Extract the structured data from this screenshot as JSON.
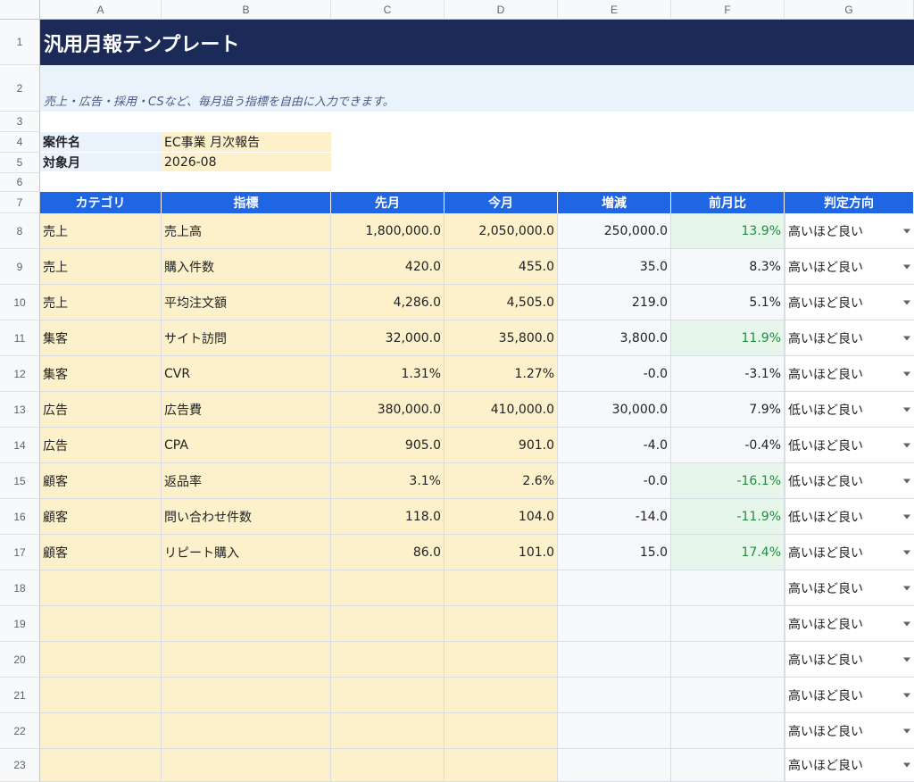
{
  "columns": [
    "A",
    "B",
    "C",
    "D",
    "E",
    "F",
    "G"
  ],
  "row_numbers": [
    "1",
    "2",
    "3",
    "4",
    "5",
    "6",
    "7",
    "8",
    "9",
    "10",
    "11",
    "12",
    "13",
    "14",
    "15",
    "16",
    "17",
    "18",
    "19",
    "20",
    "21",
    "22",
    "23"
  ],
  "title": "汎用月報テンプレート",
  "subtitle": "売上・広告・採用・CSなど、毎月追う指標を自由に入力できます。",
  "info": {
    "case_label": "案件名",
    "case_value": "EC事業 月次報告",
    "month_label": "対象月",
    "month_value": "2026-08"
  },
  "headers": [
    "カテゴリ",
    "指標",
    "先月",
    "今月",
    "増減",
    "前月比",
    "判定方向"
  ],
  "rows": [
    {
      "category": "売上",
      "metric": "売上高",
      "prev": "1,800,000.0",
      "curr": "2,050,000.0",
      "diff": "250,000.0",
      "ratio": "13.9%",
      "direction": "高いほど良い",
      "highlight": true
    },
    {
      "category": "売上",
      "metric": "購入件数",
      "prev": "420.0",
      "curr": "455.0",
      "diff": "35.0",
      "ratio": "8.3%",
      "direction": "高いほど良い",
      "highlight": false
    },
    {
      "category": "売上",
      "metric": "平均注文額",
      "prev": "4,286.0",
      "curr": "4,505.0",
      "diff": "219.0",
      "ratio": "5.1%",
      "direction": "高いほど良い",
      "highlight": false
    },
    {
      "category": "集客",
      "metric": "サイト訪問",
      "prev": "32,000.0",
      "curr": "35,800.0",
      "diff": "3,800.0",
      "ratio": "11.9%",
      "direction": "高いほど良い",
      "highlight": true
    },
    {
      "category": "集客",
      "metric": "CVR",
      "prev": "1.31%",
      "curr": "1.27%",
      "diff": "-0.0",
      "ratio": "-3.1%",
      "direction": "高いほど良い",
      "highlight": false
    },
    {
      "category": "広告",
      "metric": "広告費",
      "prev": "380,000.0",
      "curr": "410,000.0",
      "diff": "30,000.0",
      "ratio": "7.9%",
      "direction": "低いほど良い",
      "highlight": false
    },
    {
      "category": "広告",
      "metric": "CPA",
      "prev": "905.0",
      "curr": "901.0",
      "diff": "-4.0",
      "ratio": "-0.4%",
      "direction": "低いほど良い",
      "highlight": false
    },
    {
      "category": "顧客",
      "metric": "返品率",
      "prev": "3.1%",
      "curr": "2.6%",
      "diff": "-0.0",
      "ratio": "-16.1%",
      "direction": "低いほど良い",
      "highlight": true
    },
    {
      "category": "顧客",
      "metric": "問い合わせ件数",
      "prev": "118.0",
      "curr": "104.0",
      "diff": "-14.0",
      "ratio": "-11.9%",
      "direction": "低いほど良い",
      "highlight": true
    },
    {
      "category": "顧客",
      "metric": "リピート購入",
      "prev": "86.0",
      "curr": "101.0",
      "diff": "15.0",
      "ratio": "17.4%",
      "direction": "高いほど良い",
      "highlight": true
    },
    {
      "category": "",
      "metric": "",
      "prev": "",
      "curr": "",
      "diff": "",
      "ratio": "",
      "direction": "高いほど良い",
      "highlight": false
    },
    {
      "category": "",
      "metric": "",
      "prev": "",
      "curr": "",
      "diff": "",
      "ratio": "",
      "direction": "高いほど良い",
      "highlight": false
    },
    {
      "category": "",
      "metric": "",
      "prev": "",
      "curr": "",
      "diff": "",
      "ratio": "",
      "direction": "高いほど良い",
      "highlight": false
    },
    {
      "category": "",
      "metric": "",
      "prev": "",
      "curr": "",
      "diff": "",
      "ratio": "",
      "direction": "高いほど良い",
      "highlight": false
    },
    {
      "category": "",
      "metric": "",
      "prev": "",
      "curr": "",
      "diff": "",
      "ratio": "",
      "direction": "高いほど良い",
      "highlight": false
    },
    {
      "category": "",
      "metric": "",
      "prev": "",
      "curr": "",
      "diff": "",
      "ratio": "",
      "direction": "高いほど良い",
      "highlight": false
    }
  ],
  "colors": {
    "title_bg": "#1b2a57",
    "subtitle_bg": "#eaf2fc",
    "header_bg": "#1f66e5",
    "input_bg": "#fdf1cc",
    "calc_bg": "#f7f8fa",
    "good_bg": "#e6f6ea",
    "good_text": "#1e8e3e"
  },
  "icons": {
    "dropdown": "chevron-down-icon"
  }
}
